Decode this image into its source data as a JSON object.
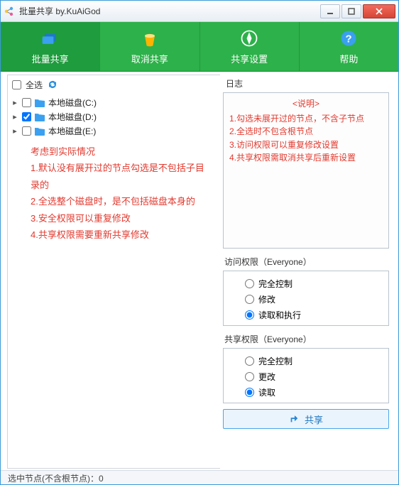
{
  "colors": {
    "toolbar": "#2db14a",
    "accent": "#2a90df",
    "danger": "#e23a2f"
  },
  "window": {
    "title": "批量共享 by.KuAiGod"
  },
  "tabs": [
    {
      "key": "batch",
      "label": "批量共享",
      "icon": "folders-icon",
      "active": true
    },
    {
      "key": "cancel",
      "label": "取消共享",
      "icon": "trash-icon",
      "active": false
    },
    {
      "key": "setting",
      "label": "共享设置",
      "icon": "compass-icon",
      "active": false
    },
    {
      "key": "help",
      "label": "帮助",
      "icon": "help-icon",
      "active": false
    }
  ],
  "select_all_label": "全选",
  "refresh_icon": "refresh-icon",
  "tree": [
    {
      "label": "本地磁盘(C:)",
      "checked": false
    },
    {
      "label": "本地磁盘(D:)",
      "checked": true
    },
    {
      "label": "本地磁盘(E:)",
      "checked": false
    }
  ],
  "notes": {
    "title": "考虑到实际情况",
    "lines": [
      "1.默认没有展开过的节点勾选是不包括子目录的",
      "2.全选整个磁盘时，是不包括磁盘本身的",
      "3.安全权限可以重复修改",
      "4.共享权限需要重新共享修改"
    ]
  },
  "log": {
    "title": "日志",
    "header": "<说明>",
    "lines": [
      "1.勾选未展开过的节点，不含子节点",
      "2.全选时不包含根节点",
      "3.访问权限可以重复修改设置",
      "4.共享权限需取消共享后重新设置"
    ]
  },
  "access": {
    "title": "访问权限（Everyone）",
    "options": [
      {
        "label": "完全控制",
        "checked": false
      },
      {
        "label": "修改",
        "checked": false
      },
      {
        "label": "读取和执行",
        "checked": true
      }
    ]
  },
  "share": {
    "title": "共享权限（Everyone）",
    "options": [
      {
        "label": "完全控制",
        "checked": false
      },
      {
        "label": "更改",
        "checked": false
      },
      {
        "label": "读取",
        "checked": true
      }
    ]
  },
  "share_button_label": "共享",
  "status": "选中节点(不含根节点)：0"
}
